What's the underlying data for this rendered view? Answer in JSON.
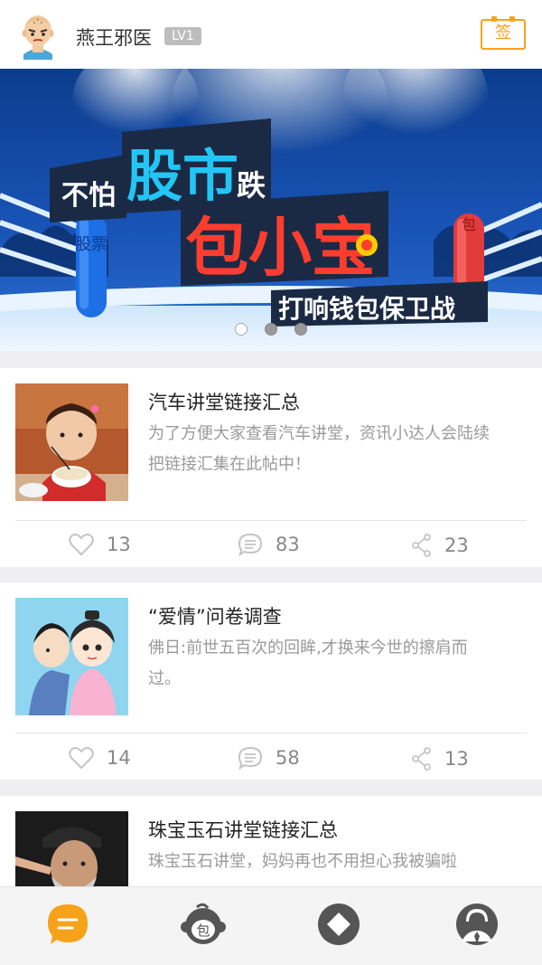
{
  "header": {
    "username": "燕王邪医",
    "level": "LV1",
    "sign_label": "签"
  },
  "banner": {
    "line1_prefix": "不怕",
    "line1_main": "股市",
    "line1_suffix": "跌",
    "line2": "包小宝",
    "line3": "打响钱包保卫战",
    "left_post_text": "股票",
    "right_post_text": "包",
    "slide_count": 3,
    "active_slide": 1
  },
  "posts": [
    {
      "title": "汽车讲堂链接汇总",
      "excerpt": "为了方便大家查看汽车讲堂，资讯小达人会陆续把链接汇集在此帖中！",
      "likes": "13",
      "comments": "83",
      "shares": "23"
    },
    {
      "title": "“爱情”问卷调查",
      "excerpt": "佛日:前世五百次的回眸,才换来今世的擦肩而过。",
      "likes": "14",
      "comments": "58",
      "shares": "13"
    },
    {
      "title": "珠宝玉石讲堂链接汇总",
      "excerpt": "珠宝玉石讲堂，妈妈再也不用担心我被骗啦"
    }
  ],
  "nav": {
    "bao_glyph": "包",
    "items": [
      "message-icon",
      "bao-monkey-icon",
      "diamond-icon",
      "profile-icon"
    ],
    "active_color": "#f7a21b",
    "inactive_color": "#555555"
  }
}
